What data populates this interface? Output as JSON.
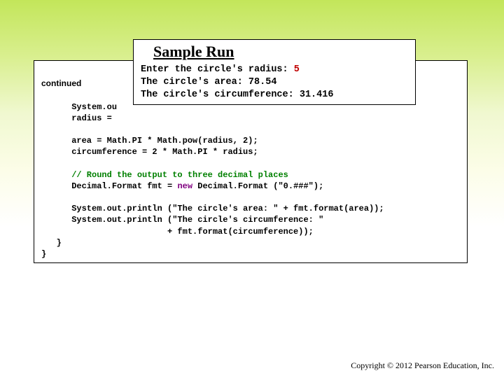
{
  "continued_label": "continued",
  "code": {
    "l1": "",
    "l2": "      System.ou",
    "l3": "      radius = ",
    "l4": "",
    "l5": "      area = Math.PI * Math.pow(radius, 2);",
    "l6": "      circumference = 2 * Math.PI * radius;",
    "l7": "",
    "c1": "      // Round the output to three decimal places",
    "l8a": "      Decimal.Format fmt = ",
    "kw_new": "new",
    "l8b": " Decimal.Format (\"0.###\");",
    "l9": "",
    "l10": "      System.out.println (\"The circle's area: \" + fmt.format(area));",
    "l11": "      System.out.println (\"The circle's circumference: \"",
    "l12": "                         + fmt.format(circumference));",
    "l13": "   }",
    "l14": "}"
  },
  "popup": {
    "title": "Sample Run",
    "p1a": "Enter the circle's radius: ",
    "p1b": "5",
    "p2": "The circle's area: 78.54",
    "p3": "The circle's circumference: 31.416"
  },
  "copyright": "Copyright © 2012 Pearson Education, Inc."
}
